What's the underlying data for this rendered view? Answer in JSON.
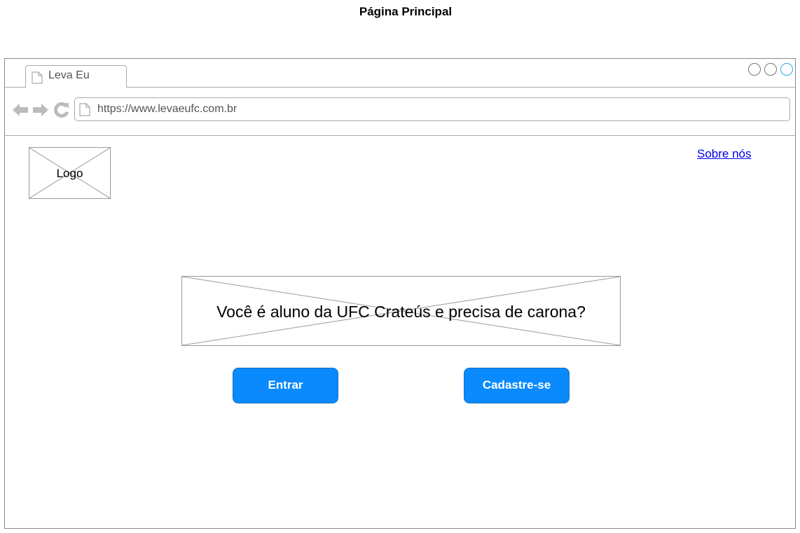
{
  "page": {
    "title": "Página Principal"
  },
  "browser": {
    "tab": {
      "label": "Leva Eu",
      "icon": "page-icon"
    },
    "url": "https://www.levaeufc.com.br",
    "window_controls": [
      "minimize",
      "maximize",
      "close"
    ],
    "nav_icons": [
      "back-arrow-icon",
      "forward-arrow-icon",
      "reload-icon"
    ],
    "accent_color": "#27a9e3"
  },
  "content": {
    "logo_label": "Logo",
    "about_link": "Sobre nós",
    "hero_text": "Você é aluno da UFC Crateús e precisa de carona?",
    "buttons": {
      "login": "Entrar",
      "signup": "Cadastre-se"
    },
    "button_color": "#0a8afc"
  }
}
